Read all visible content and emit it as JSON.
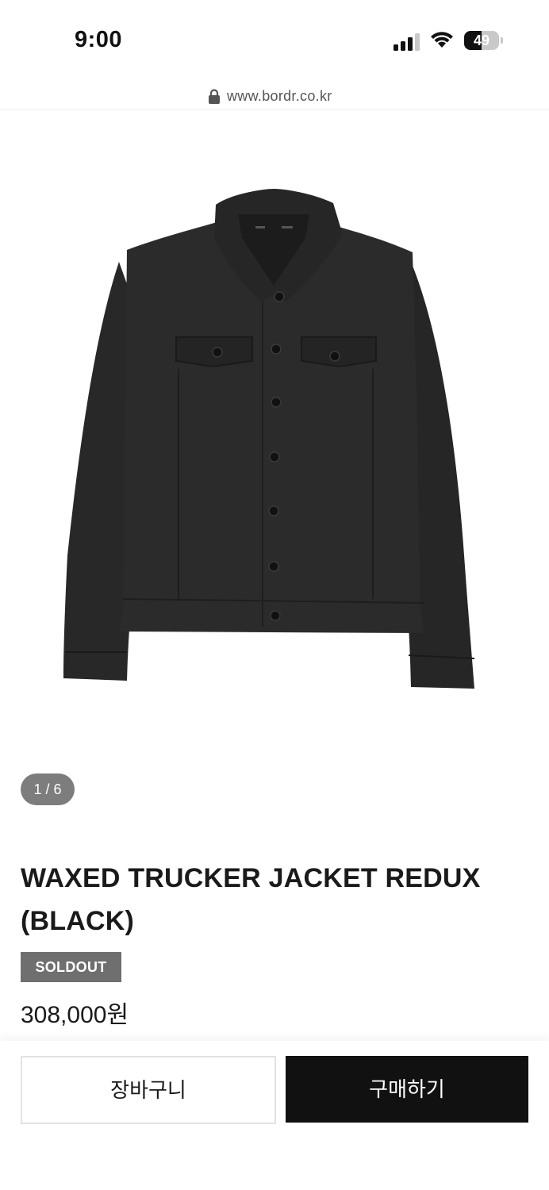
{
  "status_bar": {
    "time": "9:00",
    "battery_level": "49",
    "battery_fraction": 0.49,
    "icons": [
      "signal-icon",
      "wifi-icon",
      "battery-icon"
    ]
  },
  "browser": {
    "url": "www.bordr.co.kr",
    "icon": "lock-icon"
  },
  "product": {
    "image_counter": "1 / 6",
    "title": "WAXED TRUCKER JACKET REDUX (BLACK)",
    "status_badge": "SOLDOUT",
    "price": "308,000원"
  },
  "actions": {
    "cart_label": "장바구니",
    "buy_label": "구매하기"
  },
  "colors": {
    "background": "#ffffff",
    "badge": "#6f6f6f",
    "buy_button": "#111111",
    "counter_pill": "#7d7d7d"
  }
}
